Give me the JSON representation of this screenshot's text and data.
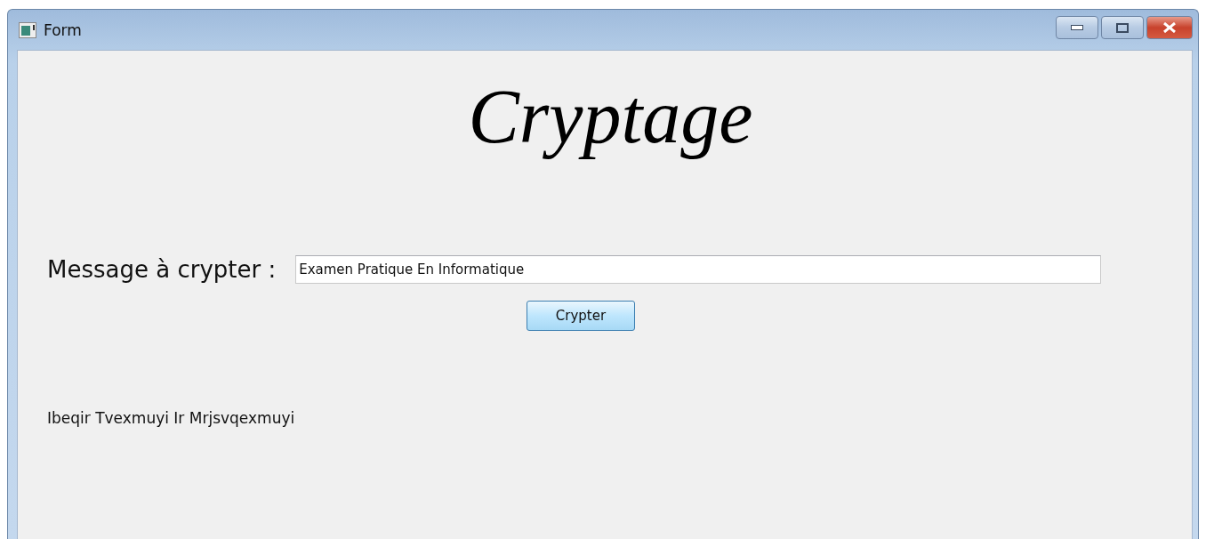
{
  "window": {
    "title": "Form"
  },
  "heading": "Cryptage",
  "form": {
    "label": "Message à crypter :",
    "value": "Examen Pratique En Informatique",
    "button": "Crypter"
  },
  "result": "Ibeqir Tvexmuyi Ir Mrjsvqexmuyi"
}
